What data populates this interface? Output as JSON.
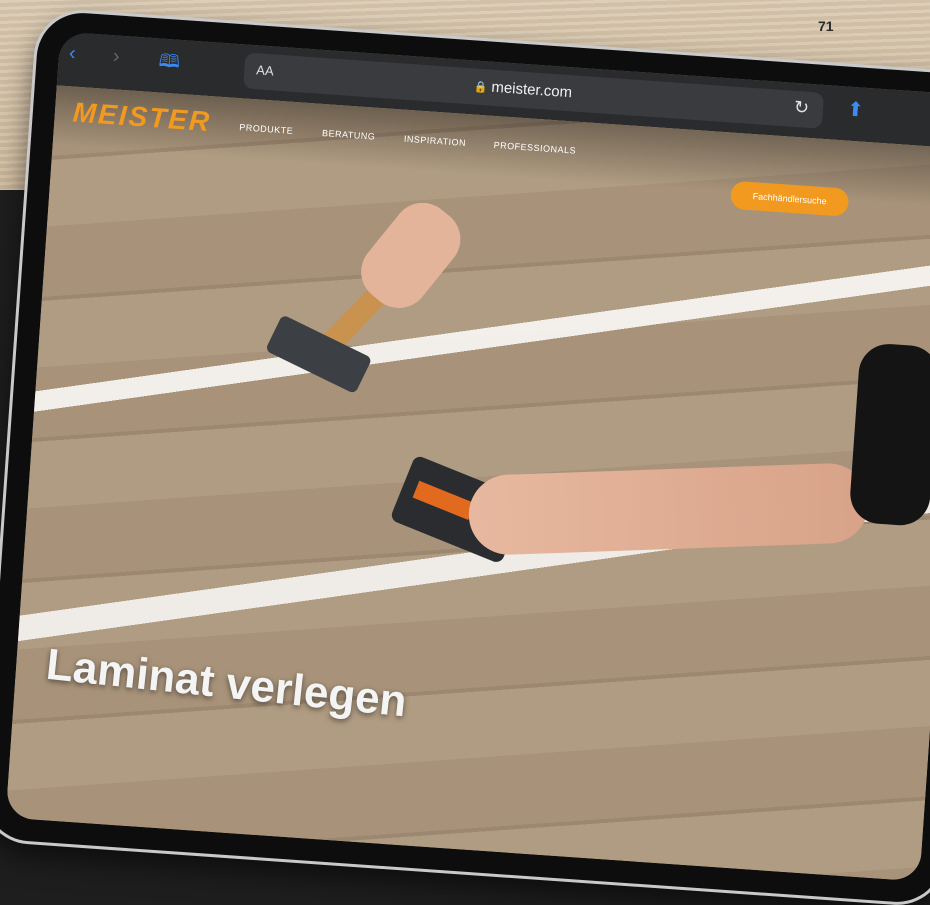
{
  "page_number": "71",
  "browser": {
    "reader_label": "AA",
    "url": "meister.com",
    "icons": {
      "back": "chevron-left-icon",
      "forward": "chevron-right-icon",
      "bookmarks": "book-icon",
      "reload": "reload-icon",
      "share": "share-icon",
      "lock": "lock-icon"
    }
  },
  "site": {
    "logo": "MEISTER",
    "nav": [
      "PRODUKTE",
      "BERATUNG",
      "INSPIRATION",
      "PROFESSIONALS"
    ],
    "cta": "Fachhändlersuche",
    "hero_title": "Laminat verlegen",
    "accent_color": "#f29a1f"
  }
}
